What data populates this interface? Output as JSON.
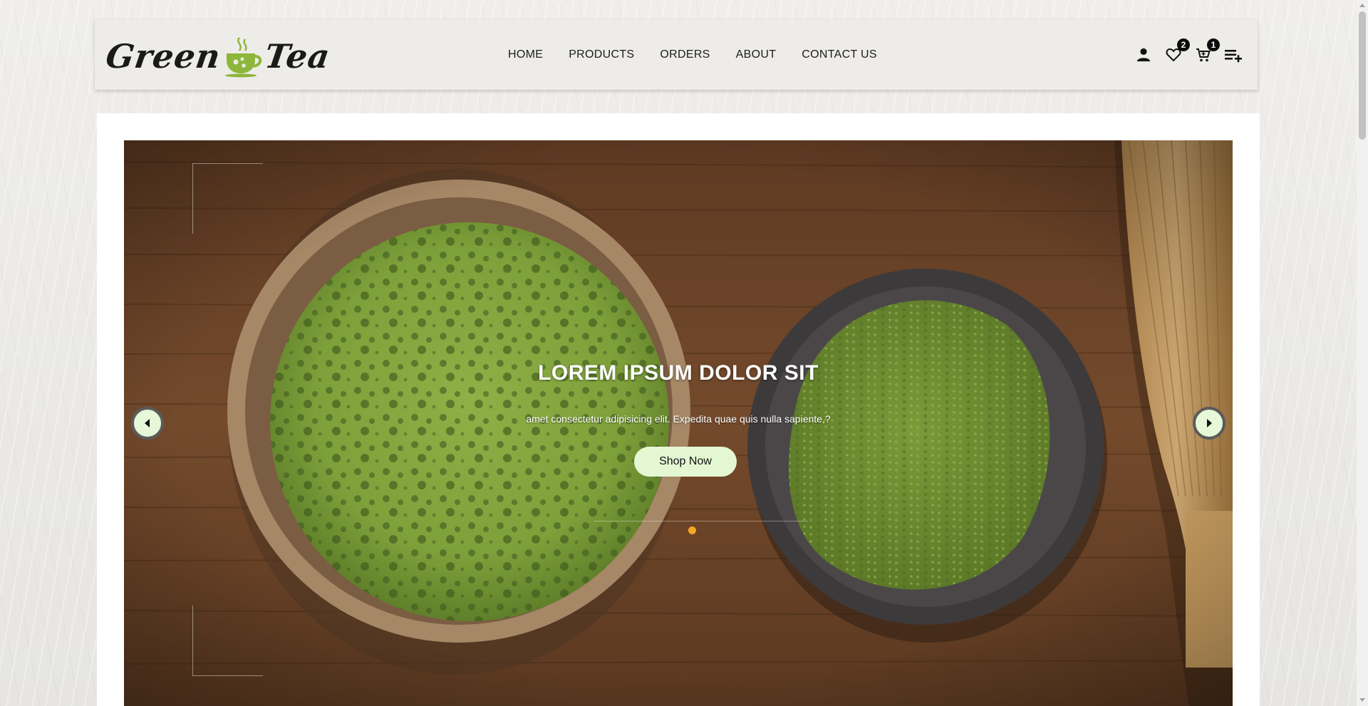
{
  "brand": {
    "logo_left": "Green",
    "logo_right": "Tea",
    "accent_color": "#8db63b"
  },
  "nav": {
    "items": [
      {
        "label": "HOME"
      },
      {
        "label": "PRODUCTS"
      },
      {
        "label": "ORDERS"
      },
      {
        "label": "ABOUT"
      },
      {
        "label": "CONTACT US"
      }
    ]
  },
  "actions": {
    "user_icon": "user-icon",
    "wishlist_icon": "heart-icon",
    "wishlist_count": "2",
    "cart_icon": "cart-icon",
    "cart_count": "1",
    "menu_icon": "playlist-add-icon"
  },
  "hero": {
    "title": "LOREM IPSUM DOLOR SIT",
    "subtitle": "amet consectetur adipisicing elit. Expedita quae quis nulla sapiente,?",
    "cta_label": "Shop Now",
    "cta_color": "#e4f7d3",
    "active_dot_color": "#f5a623",
    "prev_icon": "caret-left-icon",
    "next_icon": "caret-right-icon"
  }
}
